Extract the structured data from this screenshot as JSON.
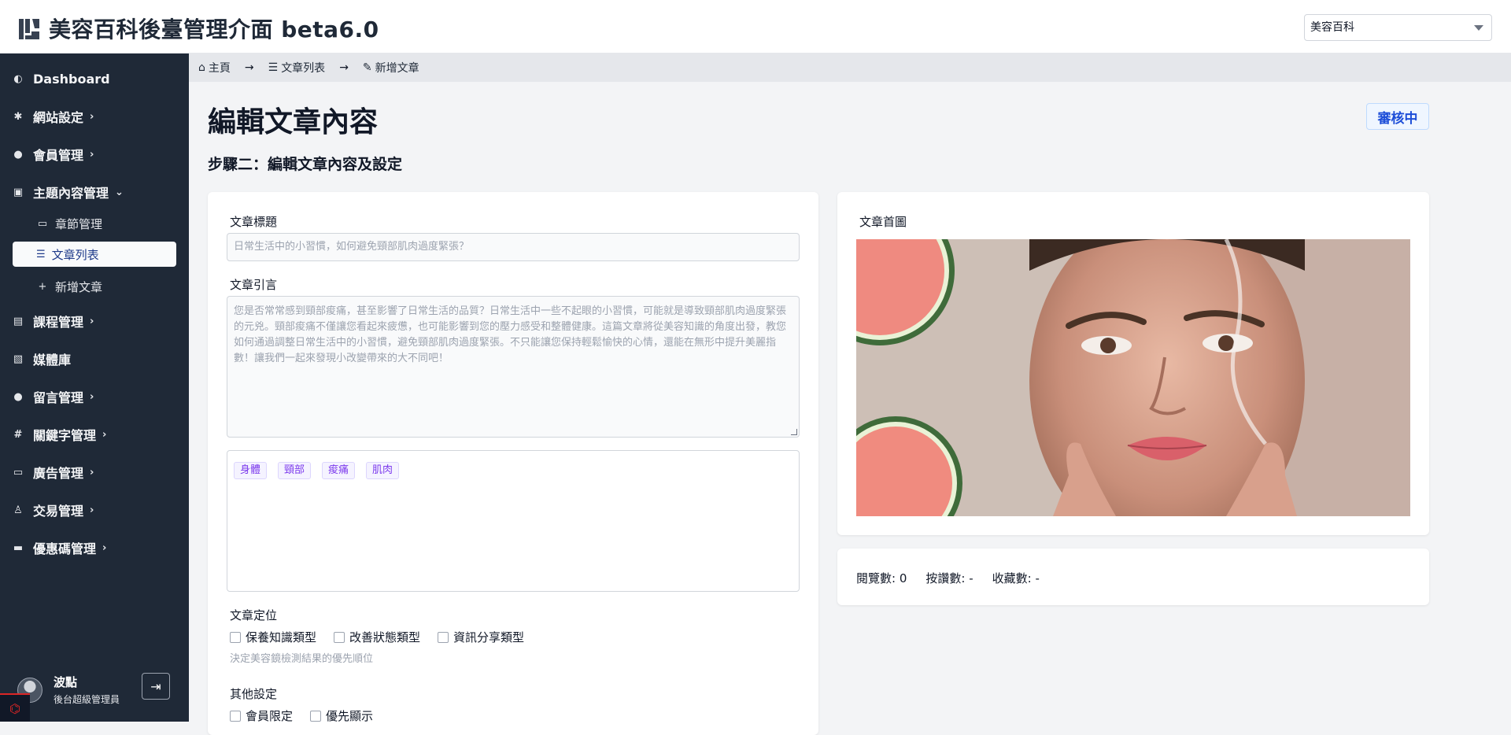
{
  "app": {
    "title": "美容百科後臺管理介面 beta6.0",
    "site_selector": "美容百科"
  },
  "sidebar": {
    "items": [
      {
        "label": "Dashboard",
        "icon": "palette-icon",
        "glyph": "◐",
        "chevron": ""
      },
      {
        "label": "網站設定",
        "icon": "gear-icon",
        "glyph": "✱",
        "chevron": "›"
      },
      {
        "label": "會員管理",
        "icon": "users-icon",
        "glyph": "👥",
        "chevron": "›"
      },
      {
        "label": "主題內容管理",
        "icon": "book-icon",
        "glyph": "▣",
        "chevron": "⌄"
      },
      {
        "label": "課程管理",
        "icon": "course-icon",
        "glyph": "▤",
        "chevron": "›"
      },
      {
        "label": "媒體庫",
        "icon": "images-icon",
        "glyph": "▧",
        "chevron": ""
      },
      {
        "label": "留言管理",
        "icon": "comment-icon",
        "glyph": "●",
        "chevron": "›"
      },
      {
        "label": "關鍵字管理",
        "icon": "hashtag-icon",
        "glyph": "#",
        "chevron": "›"
      },
      {
        "label": "廣告管理",
        "icon": "ad-icon",
        "glyph": "▭",
        "chevron": "›"
      },
      {
        "label": "交易管理",
        "icon": "money-bag-icon",
        "glyph": "♙",
        "chevron": "›"
      },
      {
        "label": "優惠碼管理",
        "icon": "ticket-icon",
        "glyph": "▬",
        "chevron": "›"
      }
    ],
    "sub_items": {
      "chapters": "章節管理",
      "articles": "文章列表",
      "new_article": "新增文章"
    },
    "user": {
      "name": "波點",
      "role": "後台超級管理員"
    }
  },
  "breadcrumb": {
    "home": "主頁",
    "list": "文章列表",
    "current": "新增文章"
  },
  "main": {
    "page_title": "編輯文章內容",
    "step_title": "步驟二：編輯文章內容及設定",
    "status": "審核中",
    "form": {
      "title_label": "文章標題",
      "title_placeholder": "日常生活中的小習慣，如何避免頸部肌肉過度緊張？",
      "excerpt_label": "文章引言",
      "excerpt_placeholder": "您是否常常感到頸部痠痛，甚至影響了日常生活的品質？日常生活中一些不起眼的小習慣，可能就是導致頸部肌肉過度緊張的元兇。頸部痠痛不僅讓您看起來疲憊，也可能影響到您的壓力感受和整體健康。這篇文章將從美容知識的角度出發，教您如何通過調整日常生活中的小習慣，避免頸部肌肉過度緊張。不只能讓您保持輕鬆愉快的心情，還能在無形中提升美麗指數！讓我們一起來發現小改變帶來的大不同吧！",
      "tags": [
        "身體",
        "頸部",
        "痠痛",
        "肌肉"
      ],
      "position_label": "文章定位",
      "position_options": [
        "保養知識類型",
        "改善狀態類型",
        "資訊分享類型"
      ],
      "position_hint": "決定美容鏡檢測結果的優先順位",
      "other_label": "其他設定",
      "other_options": [
        "會員限定",
        "優先顯示"
      ]
    },
    "cover": {
      "label": "文章首圖"
    },
    "stats": {
      "views": "閱覽數: 0",
      "likes": "按讚數: -",
      "favorites": "收藏數: -"
    }
  }
}
